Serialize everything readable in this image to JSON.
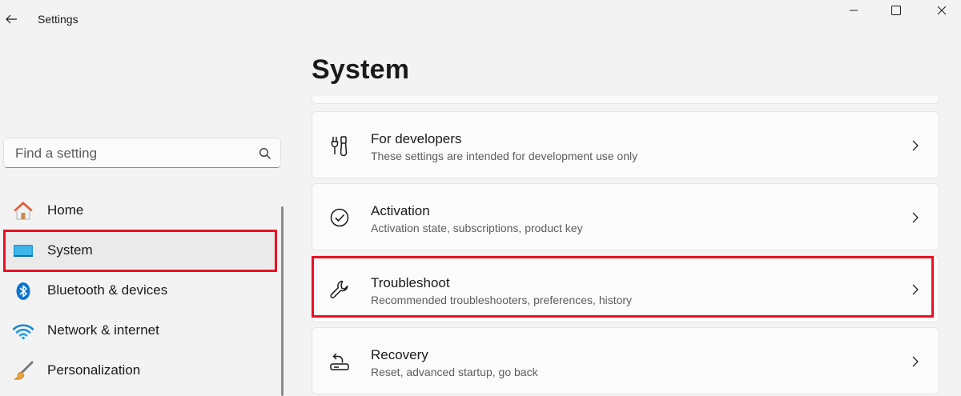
{
  "window": {
    "app_title": "Settings",
    "back_icon": "back-arrow-icon",
    "minimize_icon": "minimize-icon",
    "maximize_icon": "maximize-icon",
    "close_icon": "close-icon"
  },
  "search": {
    "placeholder": "Find a setting",
    "value": "",
    "icon": "search-icon"
  },
  "sidebar": {
    "items": [
      {
        "label": "Home",
        "icon": "home-icon",
        "selected": false
      },
      {
        "label": "System",
        "icon": "system-display-icon",
        "selected": true
      },
      {
        "label": "Bluetooth & devices",
        "icon": "bluetooth-icon",
        "selected": false
      },
      {
        "label": "Network & internet",
        "icon": "wifi-icon",
        "selected": false
      },
      {
        "label": "Personalization",
        "icon": "paintbrush-icon",
        "selected": false
      }
    ]
  },
  "main": {
    "title": "System",
    "cards": [
      {
        "title": "For developers",
        "description": "These settings are intended for development use only",
        "icon": "developer-tools-icon"
      },
      {
        "title": "Activation",
        "description": "Activation state, subscriptions, product key",
        "icon": "checkmark-circle-icon"
      },
      {
        "title": "Troubleshoot",
        "description": "Recommended troubleshooters, preferences, history",
        "icon": "wrench-icon"
      },
      {
        "title": "Recovery",
        "description": "Reset, advanced startup, go back",
        "icon": "recovery-icon"
      }
    ]
  },
  "colors": {
    "background": "#f3f3f3",
    "card": "#fbfbfb",
    "highlight": "#e81123",
    "accent": "#0067c0"
  }
}
